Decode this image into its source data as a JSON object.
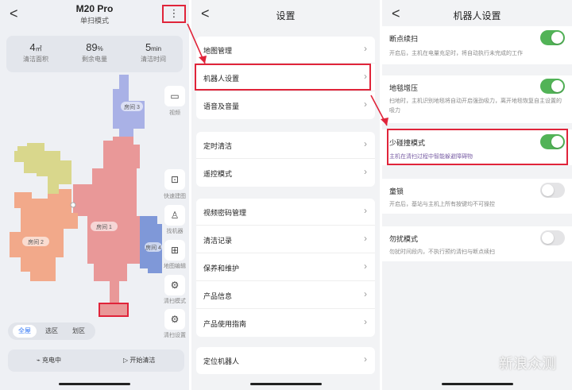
{
  "panel1": {
    "title": "M20 Pro",
    "subtitle": "单扫模式",
    "back": "<",
    "menu": "⋮",
    "stats": [
      {
        "value": "4",
        "unit": "㎡",
        "label": "清洁面积"
      },
      {
        "value": "89",
        "unit": "%",
        "label": "剩余电量"
      },
      {
        "value": "5",
        "unit": "min",
        "label": "清洁时间"
      }
    ],
    "rooms": [
      "房间 3",
      "房间 2",
      "房间 1",
      "房间 4"
    ],
    "side": [
      {
        "icon": "video-icon",
        "glyph": "▭",
        "label": "视频"
      },
      {
        "icon": "quick-map-icon",
        "glyph": "⊡",
        "label": "快速建图"
      },
      {
        "icon": "robot-icon",
        "glyph": "♙",
        "label": "找机器"
      },
      {
        "icon": "map-edit-icon",
        "glyph": "⊞",
        "label": "地图编辑"
      },
      {
        "icon": "clean-mode-icon",
        "glyph": "⚙",
        "label": "清扫模式"
      },
      {
        "icon": "clean-settings-icon",
        "glyph": "⚙",
        "label": "清扫设置"
      }
    ],
    "modes": [
      "全屋",
      "选区",
      "划区"
    ],
    "charge": "充电中",
    "start": "开始清洁"
  },
  "panel2": {
    "title": "设置",
    "groups": [
      [
        "地图管理",
        "机器人设置",
        "语音及音量"
      ],
      [
        "定时清洁",
        "遥控模式"
      ],
      [
        "视频密码管理",
        "清洁记录",
        "保养和维护",
        "产品信息",
        "产品使用指南"
      ],
      [
        "定位机器人"
      ]
    ]
  },
  "panel3": {
    "title": "机器人设置",
    "items": [
      {
        "title": "断点续扫",
        "desc": "开启后，主机在电量充足时，将自动执行未完成的工作",
        "on": true
      },
      {
        "title": "地毯增压",
        "desc": "扫地时，主机识别地毯将自动开启强劲吸力，离开地毯恢复自主设置的吸力",
        "on": true
      },
      {
        "title": "少碰撞模式",
        "desc": "主机在清扫过程中智能躲避障碍物",
        "on": true
      },
      {
        "title": "童锁",
        "desc": "开启后，基站与主机上所有按键均不可操控",
        "on": false
      },
      {
        "title": "勿扰模式",
        "desc": "勿扰时间段内，不执行预约清扫与断点续扫",
        "on": false
      }
    ]
  },
  "watermark": "新浪众测",
  "colors": {
    "accent": "#3478f6",
    "toggle_on": "#52b357",
    "highlight": "#e0243a"
  }
}
